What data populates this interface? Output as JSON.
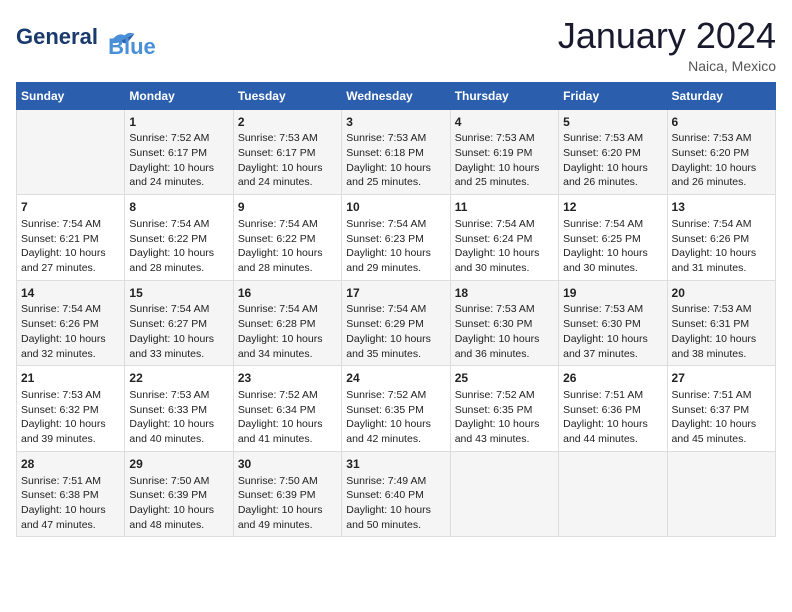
{
  "header": {
    "logo_line1": "General",
    "logo_line2": "Blue",
    "month": "January 2024",
    "location": "Naica, Mexico"
  },
  "days_of_week": [
    "Sunday",
    "Monday",
    "Tuesday",
    "Wednesday",
    "Thursday",
    "Friday",
    "Saturday"
  ],
  "weeks": [
    [
      {
        "day": "",
        "content": ""
      },
      {
        "day": "1",
        "content": "Sunrise: 7:52 AM\nSunset: 6:17 PM\nDaylight: 10 hours\nand 24 minutes."
      },
      {
        "day": "2",
        "content": "Sunrise: 7:53 AM\nSunset: 6:17 PM\nDaylight: 10 hours\nand 24 minutes."
      },
      {
        "day": "3",
        "content": "Sunrise: 7:53 AM\nSunset: 6:18 PM\nDaylight: 10 hours\nand 25 minutes."
      },
      {
        "day": "4",
        "content": "Sunrise: 7:53 AM\nSunset: 6:19 PM\nDaylight: 10 hours\nand 25 minutes."
      },
      {
        "day": "5",
        "content": "Sunrise: 7:53 AM\nSunset: 6:20 PM\nDaylight: 10 hours\nand 26 minutes."
      },
      {
        "day": "6",
        "content": "Sunrise: 7:53 AM\nSunset: 6:20 PM\nDaylight: 10 hours\nand 26 minutes."
      }
    ],
    [
      {
        "day": "7",
        "content": "Sunrise: 7:54 AM\nSunset: 6:21 PM\nDaylight: 10 hours\nand 27 minutes."
      },
      {
        "day": "8",
        "content": "Sunrise: 7:54 AM\nSunset: 6:22 PM\nDaylight: 10 hours\nand 28 minutes."
      },
      {
        "day": "9",
        "content": "Sunrise: 7:54 AM\nSunset: 6:22 PM\nDaylight: 10 hours\nand 28 minutes."
      },
      {
        "day": "10",
        "content": "Sunrise: 7:54 AM\nSunset: 6:23 PM\nDaylight: 10 hours\nand 29 minutes."
      },
      {
        "day": "11",
        "content": "Sunrise: 7:54 AM\nSunset: 6:24 PM\nDaylight: 10 hours\nand 30 minutes."
      },
      {
        "day": "12",
        "content": "Sunrise: 7:54 AM\nSunset: 6:25 PM\nDaylight: 10 hours\nand 30 minutes."
      },
      {
        "day": "13",
        "content": "Sunrise: 7:54 AM\nSunset: 6:26 PM\nDaylight: 10 hours\nand 31 minutes."
      }
    ],
    [
      {
        "day": "14",
        "content": "Sunrise: 7:54 AM\nSunset: 6:26 PM\nDaylight: 10 hours\nand 32 minutes."
      },
      {
        "day": "15",
        "content": "Sunrise: 7:54 AM\nSunset: 6:27 PM\nDaylight: 10 hours\nand 33 minutes."
      },
      {
        "day": "16",
        "content": "Sunrise: 7:54 AM\nSunset: 6:28 PM\nDaylight: 10 hours\nand 34 minutes."
      },
      {
        "day": "17",
        "content": "Sunrise: 7:54 AM\nSunset: 6:29 PM\nDaylight: 10 hours\nand 35 minutes."
      },
      {
        "day": "18",
        "content": "Sunrise: 7:53 AM\nSunset: 6:30 PM\nDaylight: 10 hours\nand 36 minutes."
      },
      {
        "day": "19",
        "content": "Sunrise: 7:53 AM\nSunset: 6:30 PM\nDaylight: 10 hours\nand 37 minutes."
      },
      {
        "day": "20",
        "content": "Sunrise: 7:53 AM\nSunset: 6:31 PM\nDaylight: 10 hours\nand 38 minutes."
      }
    ],
    [
      {
        "day": "21",
        "content": "Sunrise: 7:53 AM\nSunset: 6:32 PM\nDaylight: 10 hours\nand 39 minutes."
      },
      {
        "day": "22",
        "content": "Sunrise: 7:53 AM\nSunset: 6:33 PM\nDaylight: 10 hours\nand 40 minutes."
      },
      {
        "day": "23",
        "content": "Sunrise: 7:52 AM\nSunset: 6:34 PM\nDaylight: 10 hours\nand 41 minutes."
      },
      {
        "day": "24",
        "content": "Sunrise: 7:52 AM\nSunset: 6:35 PM\nDaylight: 10 hours\nand 42 minutes."
      },
      {
        "day": "25",
        "content": "Sunrise: 7:52 AM\nSunset: 6:35 PM\nDaylight: 10 hours\nand 43 minutes."
      },
      {
        "day": "26",
        "content": "Sunrise: 7:51 AM\nSunset: 6:36 PM\nDaylight: 10 hours\nand 44 minutes."
      },
      {
        "day": "27",
        "content": "Sunrise: 7:51 AM\nSunset: 6:37 PM\nDaylight: 10 hours\nand 45 minutes."
      }
    ],
    [
      {
        "day": "28",
        "content": "Sunrise: 7:51 AM\nSunset: 6:38 PM\nDaylight: 10 hours\nand 47 minutes."
      },
      {
        "day": "29",
        "content": "Sunrise: 7:50 AM\nSunset: 6:39 PM\nDaylight: 10 hours\nand 48 minutes."
      },
      {
        "day": "30",
        "content": "Sunrise: 7:50 AM\nSunset: 6:39 PM\nDaylight: 10 hours\nand 49 minutes."
      },
      {
        "day": "31",
        "content": "Sunrise: 7:49 AM\nSunset: 6:40 PM\nDaylight: 10 hours\nand 50 minutes."
      },
      {
        "day": "",
        "content": ""
      },
      {
        "day": "",
        "content": ""
      },
      {
        "day": "",
        "content": ""
      }
    ]
  ]
}
